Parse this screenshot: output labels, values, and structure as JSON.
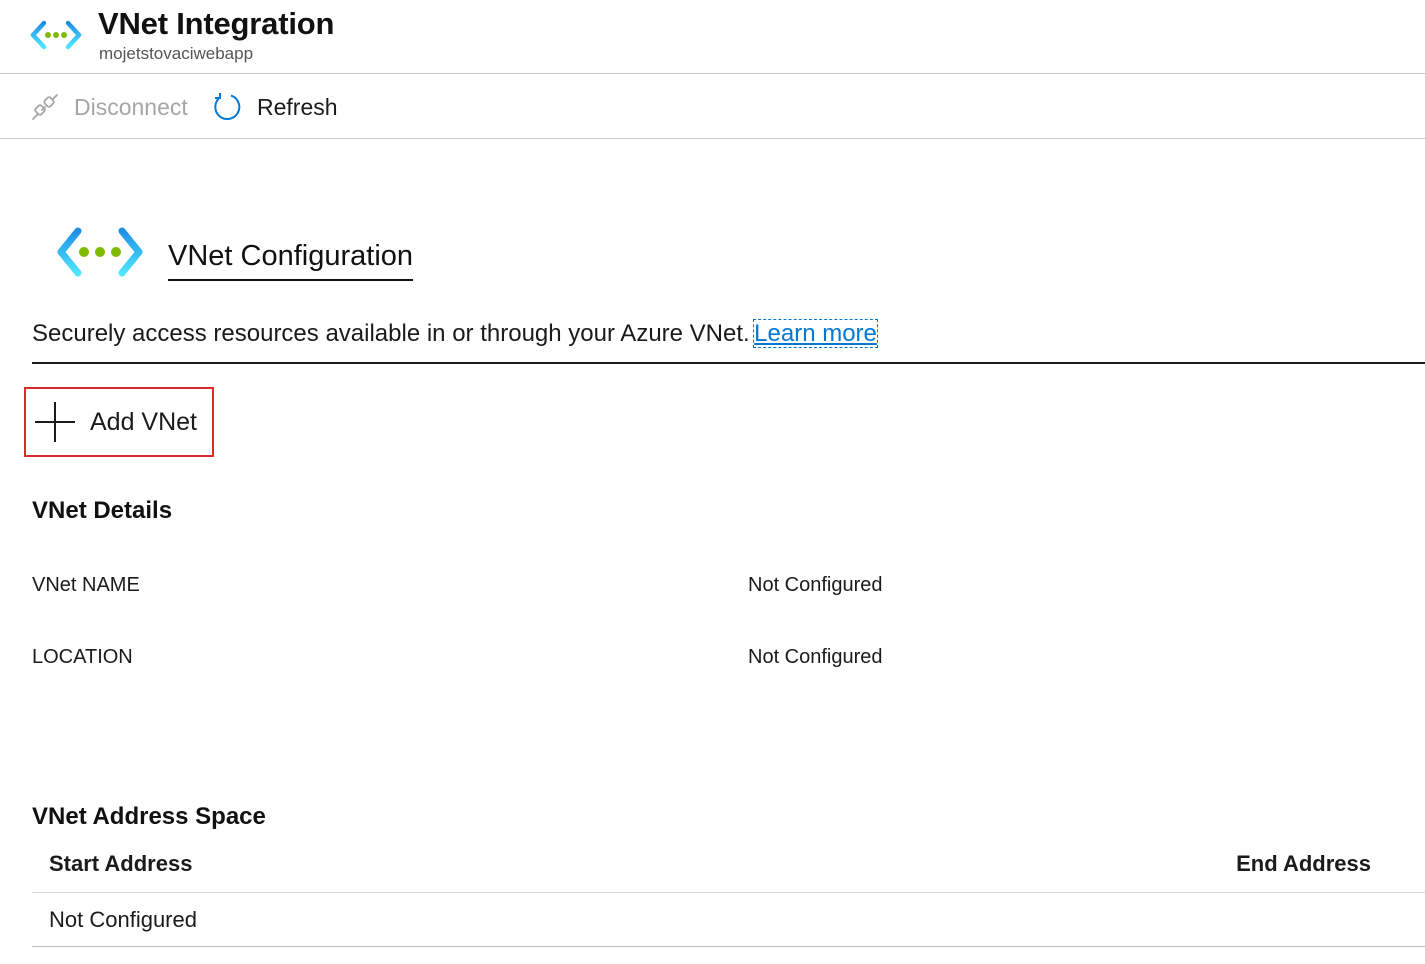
{
  "header": {
    "title": "VNet Integration",
    "subtitle": "mojetstovaciwebapp",
    "icon": "vnet-icon"
  },
  "toolbar": {
    "disconnect_label": "Disconnect",
    "disconnect_icon": "plug-disconnect-icon",
    "disconnect_enabled": false,
    "refresh_label": "Refresh",
    "refresh_icon": "refresh-icon"
  },
  "config": {
    "title": "VNet Configuration",
    "description": "Securely access resources available in or through your Azure VNet.",
    "learn_more": "Learn more"
  },
  "add_vnet": {
    "label": "Add VNet",
    "icon": "plus-icon",
    "highlight_color": "#d92b2b"
  },
  "details": {
    "heading": "VNet Details",
    "rows": [
      {
        "label": "VNet NAME",
        "value": "Not Configured"
      },
      {
        "label": "LOCATION",
        "value": "Not Configured"
      }
    ]
  },
  "address_space": {
    "heading": "VNet Address Space",
    "columns": [
      "Start Address",
      "End Address"
    ],
    "rows": [
      {
        "start": "Not Configured",
        "end": ""
      }
    ]
  },
  "colors": {
    "accent": "#0078d4",
    "vnet_green": "#7fba00",
    "vnet_blue_light": "#50e6ff",
    "disabled_text": "#a6a6a6"
  }
}
